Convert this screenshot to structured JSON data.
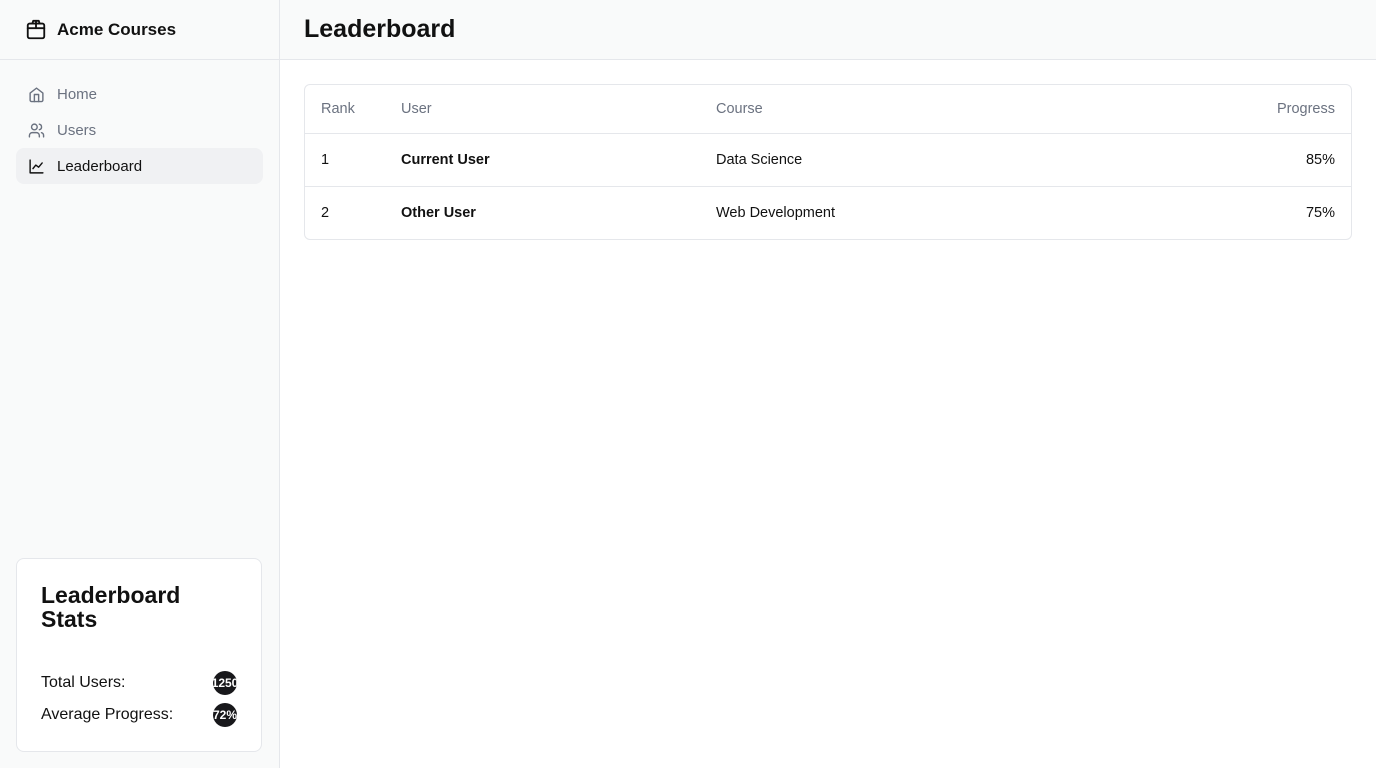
{
  "app": {
    "name": "Acme Courses",
    "brand_icon": "package-icon"
  },
  "nav": {
    "items": [
      {
        "label": "Home",
        "icon": "home-icon"
      },
      {
        "label": "Users",
        "icon": "users-icon"
      },
      {
        "label": "Leaderboard",
        "icon": "line-chart-icon",
        "active": true
      }
    ]
  },
  "stats": {
    "title": "Leaderboard Stats",
    "total_users_label": "Total Users:",
    "total_users_value": "1250",
    "avg_progress_label": "Average Progress:",
    "avg_progress_value": "72%"
  },
  "header": {
    "title": "Leaderboard"
  },
  "table": {
    "columns": {
      "rank": "Rank",
      "user": "User",
      "course": "Course",
      "progress": "Progress"
    },
    "rows": [
      {
        "rank": "1",
        "user": "Current User",
        "course": "Data Science",
        "progress": "85%"
      },
      {
        "rank": "2",
        "user": "Other User",
        "course": "Web Development",
        "progress": "75%"
      }
    ]
  }
}
